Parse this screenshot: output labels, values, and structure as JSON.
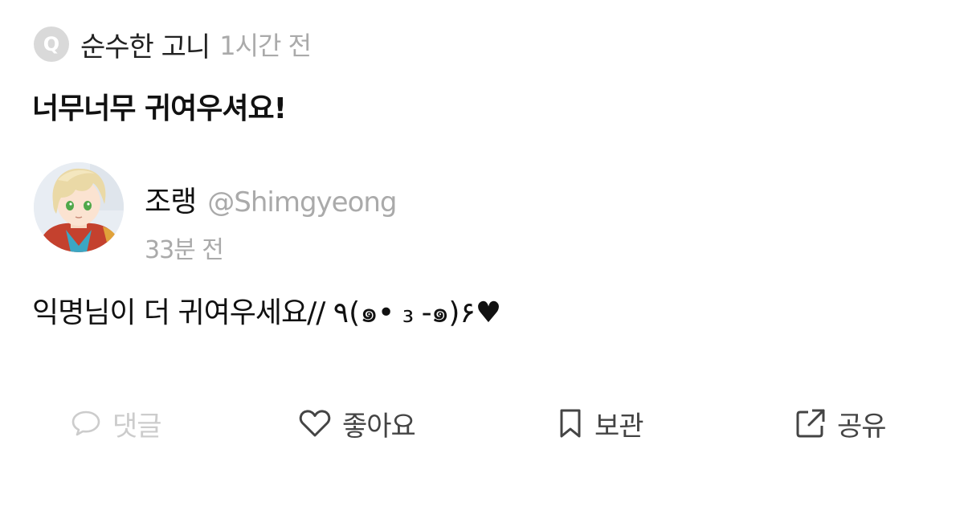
{
  "question": {
    "badge": "Q",
    "asker": "순수한 고니",
    "time": "1시간 전",
    "text": "너무너무 귀여우셔요!"
  },
  "answer": {
    "name": "조랭",
    "handle": "@Shimgyeong",
    "time": "33분 전",
    "text": "익명님이 더 귀여우세요// ٩(๑• ₃ -๑)۶♥"
  },
  "actions": {
    "comment": {
      "label": "댓글",
      "icon": "speech-bubble-icon",
      "disabled": true
    },
    "like": {
      "label": "좋아요",
      "icon": "heart-icon"
    },
    "save": {
      "label": "보관",
      "icon": "bookmark-icon"
    },
    "share": {
      "label": "공유",
      "icon": "share-icon"
    }
  },
  "colors": {
    "text_primary": "#111111",
    "text_secondary": "#aaaaaa",
    "badge_bg": "#d9d9d9",
    "action_text": "#444444",
    "action_disabled": "#cccccc"
  }
}
